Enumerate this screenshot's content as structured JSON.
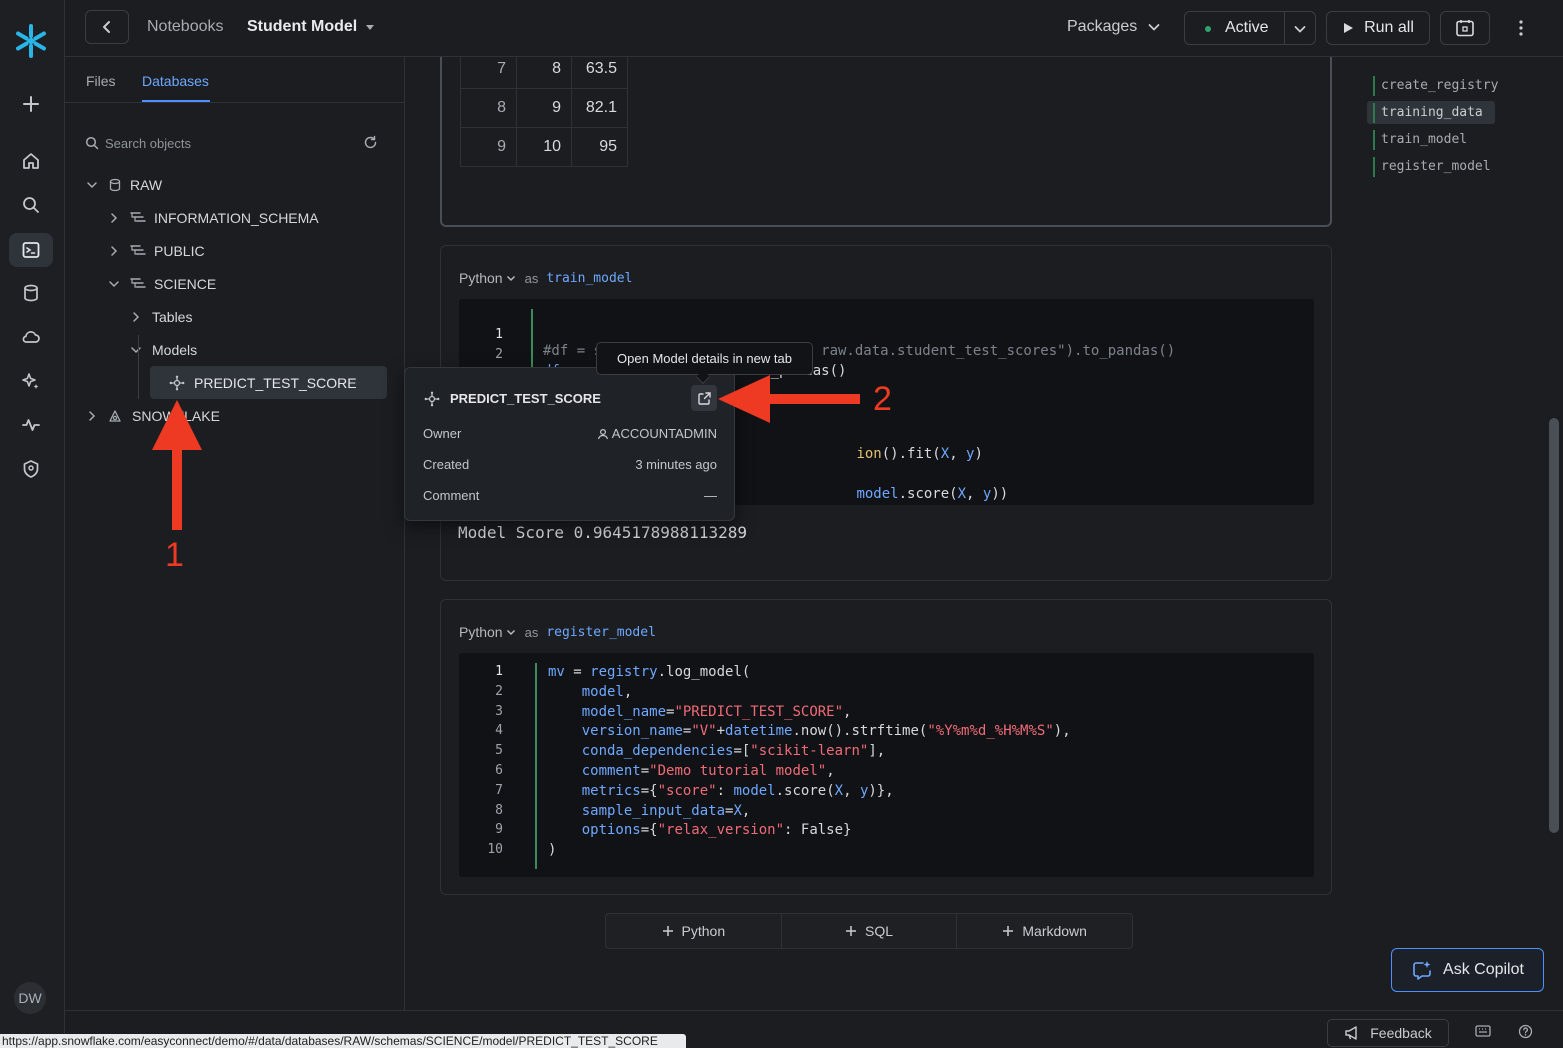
{
  "header": {
    "breadcrumb_root": "Notebooks",
    "title": "Student Model",
    "packages_label": "Packages",
    "status_label": "Active",
    "run_all_label": "Run all"
  },
  "rail": {
    "avatar_initials": "DW",
    "items": [
      "logo-icon",
      "plus-icon",
      "home-icon",
      "search-icon",
      "notebook-icon",
      "database-icon",
      "cloud-icon",
      "sparkle-icon",
      "activity-icon",
      "shield-icon"
    ]
  },
  "left_panel": {
    "tabs": [
      "Files",
      "Databases"
    ],
    "active_tab": "Databases",
    "search_placeholder": "Search objects",
    "tree": {
      "raw": "RAW",
      "information_schema": "INFORMATION_SCHEMA",
      "public": "PUBLIC",
      "science": "SCIENCE",
      "tables": "Tables",
      "models": "Models",
      "model": "PREDICT_TEST_SCORE",
      "snowflake": "SNOWFLAKE"
    }
  },
  "top_cell": {
    "rows": [
      {
        "idx": "7",
        "c1": "8",
        "c2": "63.5"
      },
      {
        "idx": "8",
        "c1": "9",
        "c2": "82.1"
      },
      {
        "idx": "9",
        "c1": "10",
        "c2": "95"
      }
    ]
  },
  "train_cell": {
    "language": "Python",
    "as_label": "as",
    "name": "train_model",
    "line_numbers": [
      "1",
      "2",
      "3"
    ],
    "code_line1": "#df = session.sql(\"select * from raw.data.student_test_scores\").to_pandas()",
    "code_line2_pre": "df = ",
    "code_line2_var": "cells",
    "code_line2_rest": ".training_data.to_pandas()",
    "code_frag_fit_a": "ion",
    "code_frag_fit_b": "().fit(",
    "code_frag_fit_x": "X",
    "code_frag_fit_c": ", ",
    "code_frag_fit_y": "y",
    "code_frag_fit_d": ")",
    "code_frag_score_a": "model",
    "code_frag_score_b": ".score(",
    "code_frag_score_x": "X",
    "code_frag_score_c": ", ",
    "code_frag_score_y": "y",
    "code_frag_score_d": "))",
    "output": "Model Score 0.9645178988113289"
  },
  "register_cell": {
    "language": "Python",
    "as_label": "as",
    "name": "register_model",
    "lines": [
      {
        "n": "1",
        "parts": [
          [
            "var",
            "mv"
          ],
          [
            "txt",
            " = "
          ],
          [
            "var",
            "registry"
          ],
          [
            "txt",
            ".log_model("
          ]
        ]
      },
      {
        "n": "2",
        "parts": [
          [
            "txt",
            "    "
          ],
          [
            "var",
            "model"
          ],
          [
            "txt",
            ","
          ]
        ]
      },
      {
        "n": "3",
        "parts": [
          [
            "txt",
            "    "
          ],
          [
            "var",
            "model_name"
          ],
          [
            "txt",
            "="
          ],
          [
            "str",
            "\"PREDICT_TEST_SCORE\""
          ],
          [
            "txt",
            ","
          ]
        ]
      },
      {
        "n": "4",
        "parts": [
          [
            "txt",
            "    "
          ],
          [
            "var",
            "version_name"
          ],
          [
            "txt",
            "="
          ],
          [
            "str",
            "\"V\""
          ],
          [
            "txt",
            "+"
          ],
          [
            "var",
            "datetime"
          ],
          [
            "txt",
            ".now().strftime("
          ],
          [
            "str",
            "\"%Y%m%d_%H%M%S\""
          ],
          [
            "txt",
            "),"
          ]
        ]
      },
      {
        "n": "5",
        "parts": [
          [
            "txt",
            "    "
          ],
          [
            "var",
            "conda_dependencies"
          ],
          [
            "txt",
            "=["
          ],
          [
            "str",
            "\"scikit-learn\""
          ],
          [
            "txt",
            "],"
          ]
        ]
      },
      {
        "n": "6",
        "parts": [
          [
            "txt",
            "    "
          ],
          [
            "var",
            "comment"
          ],
          [
            "txt",
            "="
          ],
          [
            "str",
            "\"Demo tutorial model\""
          ],
          [
            "txt",
            ","
          ]
        ]
      },
      {
        "n": "7",
        "parts": [
          [
            "txt",
            "    "
          ],
          [
            "var",
            "metrics"
          ],
          [
            "txt",
            "={"
          ],
          [
            "str",
            "\"score\""
          ],
          [
            "txt",
            ": "
          ],
          [
            "var",
            "model"
          ],
          [
            "txt",
            ".score("
          ],
          [
            "var",
            "X"
          ],
          [
            "txt",
            ", "
          ],
          [
            "var",
            "y"
          ],
          [
            "txt",
            ")},"
          ]
        ]
      },
      {
        "n": "8",
        "parts": [
          [
            "txt",
            "    "
          ],
          [
            "var",
            "sample_input_data"
          ],
          [
            "txt",
            "="
          ],
          [
            "var",
            "X"
          ],
          [
            "txt",
            ","
          ]
        ]
      },
      {
        "n": "9",
        "parts": [
          [
            "txt",
            "    "
          ],
          [
            "var",
            "options"
          ],
          [
            "txt",
            "={"
          ],
          [
            "str",
            "\"relax_version\""
          ],
          [
            "txt",
            ": False}"
          ]
        ]
      },
      {
        "n": "10",
        "parts": [
          [
            "txt",
            ")"
          ]
        ]
      }
    ]
  },
  "add_cell": {
    "python": "Python",
    "sql": "SQL",
    "markdown": "Markdown"
  },
  "outline": [
    "create_registry",
    "training_data",
    "train_model",
    "register_model"
  ],
  "popover": {
    "title": "PREDICT_TEST_SCORE",
    "owner_label": "Owner",
    "owner_value": "ACCOUNTADMIN",
    "created_label": "Created",
    "created_value": "3 minutes ago",
    "comment_label": "Comment",
    "comment_value": "—",
    "tooltip": "Open Model details in new tab"
  },
  "annotations": {
    "one": "1",
    "two": "2",
    "color": "#ee3a23"
  },
  "footer": {
    "feedback_label": "Feedback",
    "ask_copilot_label": "Ask Copilot",
    "status_url": "https://app.snowflake.com/easyconnect/demo/#/data/databases/RAW/schemas/SCIENCE/model/PREDICT_TEST_SCORE"
  },
  "colors": {
    "accent": "#4d90fe",
    "active_dot": "#2fa36b",
    "annotation": "#ee3a23"
  }
}
